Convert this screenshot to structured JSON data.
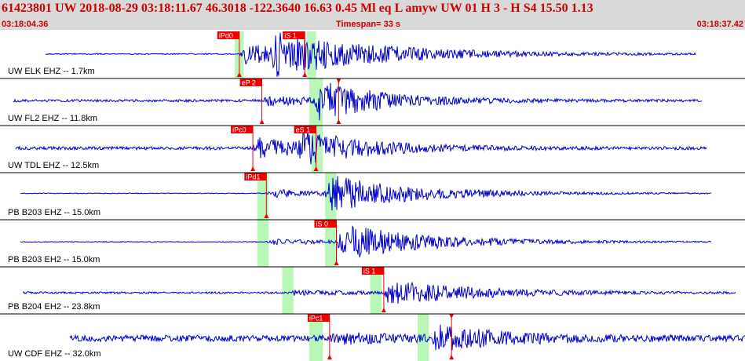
{
  "header": {
    "title": "61423801 UW 2018-08-29 03:18:11.67   46.3018 -122.3640  16.63  0.45 Ml  eq  L amyw     UW 01  H   3  -  H S4   15.50  1.13",
    "start_time": "03:18:04.36",
    "end_time": "03:18:37.42",
    "timespan": "Timespan=  33 s"
  },
  "colors": {
    "header_bg": "#d9d9d9",
    "header_text": "#cc0000",
    "trace": "#0000cc",
    "pick": "#ee0000",
    "window": "#b9f7b9",
    "separator": "#000000"
  },
  "chart_data": {
    "type": "seismogram",
    "time_axis": {
      "start": "03:18:04.36",
      "end": "03:18:37.42",
      "span_s": 33
    },
    "traces": [
      {
        "label": "UW ELK EHZ -- 1.7km",
        "picks": [
          {
            "label": "iPd0",
            "t": 10.6
          },
          {
            "label": "iS 1",
            "t": 13.5
          }
        ],
        "windows": [
          [
            10.4,
            10.8
          ],
          [
            13.6,
            14.0
          ]
        ]
      },
      {
        "label": "UW FL2 EHZ -- 11.8km",
        "picks": [
          {
            "label": "eP 2",
            "t": 11.6
          },
          {
            "label": "",
            "t": 15.0
          }
        ],
        "windows": [
          [
            13.7,
            14.3
          ]
        ]
      },
      {
        "label": "UW TDL EHZ -- 12.5km",
        "picks": [
          {
            "label": "iPc0",
            "t": 11.2
          },
          {
            "label": "eS 1",
            "t": 14.0
          }
        ],
        "windows": [
          [
            13.8,
            14.3
          ]
        ]
      },
      {
        "label": "PB B203 EHZ -- 15.0km",
        "picks": [
          {
            "label": "iPd1",
            "t": 11.8
          }
        ],
        "windows": [
          [
            11.4,
            11.9
          ],
          [
            14.4,
            14.9
          ]
        ]
      },
      {
        "label": "PB B203 EH2 -- 15.0km",
        "picks": [
          {
            "label": "iS 0",
            "t": 14.9
          }
        ],
        "windows": [
          [
            11.4,
            11.9
          ],
          [
            14.4,
            14.9
          ]
        ]
      },
      {
        "label": "PB B204 EH2 -- 23.8km",
        "picks": [
          {
            "label": "iS 1",
            "t": 17.0
          }
        ],
        "windows": [
          [
            12.5,
            13.0
          ],
          [
            16.4,
            16.9
          ]
        ]
      },
      {
        "label": "UW CDF EHZ -- 32.0km",
        "picks": [
          {
            "label": "iPc1",
            "t": 14.6
          },
          {
            "label": "",
            "t": 20.0
          }
        ],
        "windows": [
          [
            13.7,
            14.3
          ],
          [
            18.5,
            19.0
          ]
        ]
      }
    ]
  }
}
